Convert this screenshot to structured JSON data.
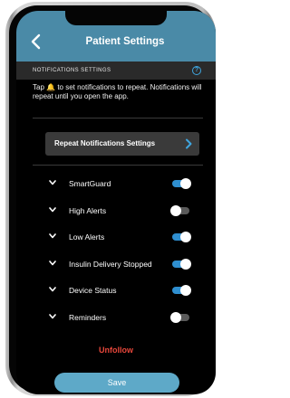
{
  "header": {
    "title": "Patient Settings",
    "back_icon": "chevron-left-icon"
  },
  "section": {
    "title": "NOTIFICATIONS SETTINGS",
    "help_icon": "?"
  },
  "info": {
    "prefix": "Tap ",
    "icon": "🔔",
    "text": " to set notifications to repeat. Notifications will repeat until you open the app."
  },
  "repeat_button": {
    "label": "Repeat Notifications Settings"
  },
  "settings": [
    {
      "label": "SmartGuard",
      "enabled": true
    },
    {
      "label": "High Alerts",
      "enabled": false
    },
    {
      "label": "Low Alerts",
      "enabled": true
    },
    {
      "label": "Insulin Delivery Stopped",
      "enabled": true
    },
    {
      "label": "Device Status",
      "enabled": true
    },
    {
      "label": "Reminders",
      "enabled": false
    }
  ],
  "unfollow": {
    "label": "Unfollow"
  },
  "save": {
    "label": "Save"
  },
  "colors": {
    "header": "#4a8aa7",
    "toggle_on": "#2f8fd0",
    "toggle_off": "#5a5a5a",
    "unfollow": "#e8473b",
    "save_button": "#5ea9c8"
  }
}
